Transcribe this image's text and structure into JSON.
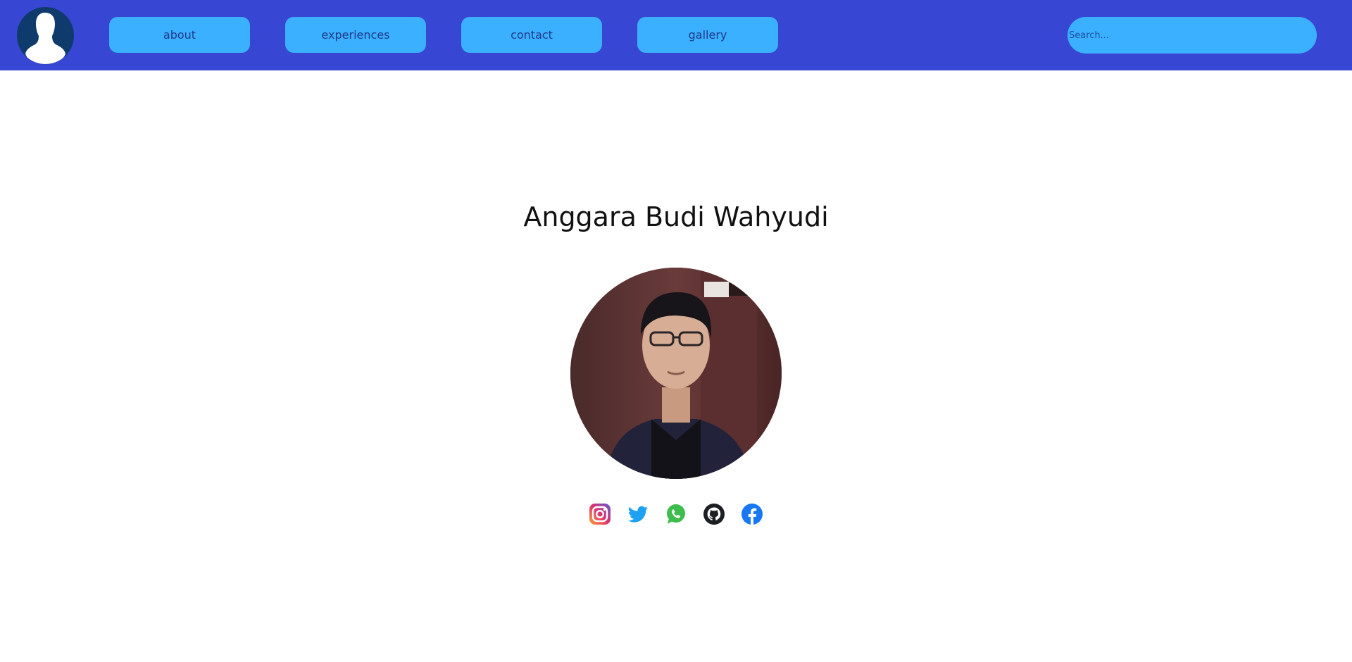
{
  "nav": {
    "items": [
      {
        "label": "about"
      },
      {
        "label": "experiences"
      },
      {
        "label": "contact"
      },
      {
        "label": "gallery"
      }
    ],
    "search_placeholder": "Search..."
  },
  "profile": {
    "name": "Anggara Budi Wahyudi"
  },
  "socials": [
    {
      "icon": "instagram-icon"
    },
    {
      "icon": "twitter-icon"
    },
    {
      "icon": "whatsapp-icon"
    },
    {
      "icon": "github-icon"
    },
    {
      "icon": "facebook-icon"
    }
  ],
  "colors": {
    "navbar": "#3746d3",
    "nav_button": "#3ab0ff",
    "nav_text": "#1e3a8a"
  }
}
